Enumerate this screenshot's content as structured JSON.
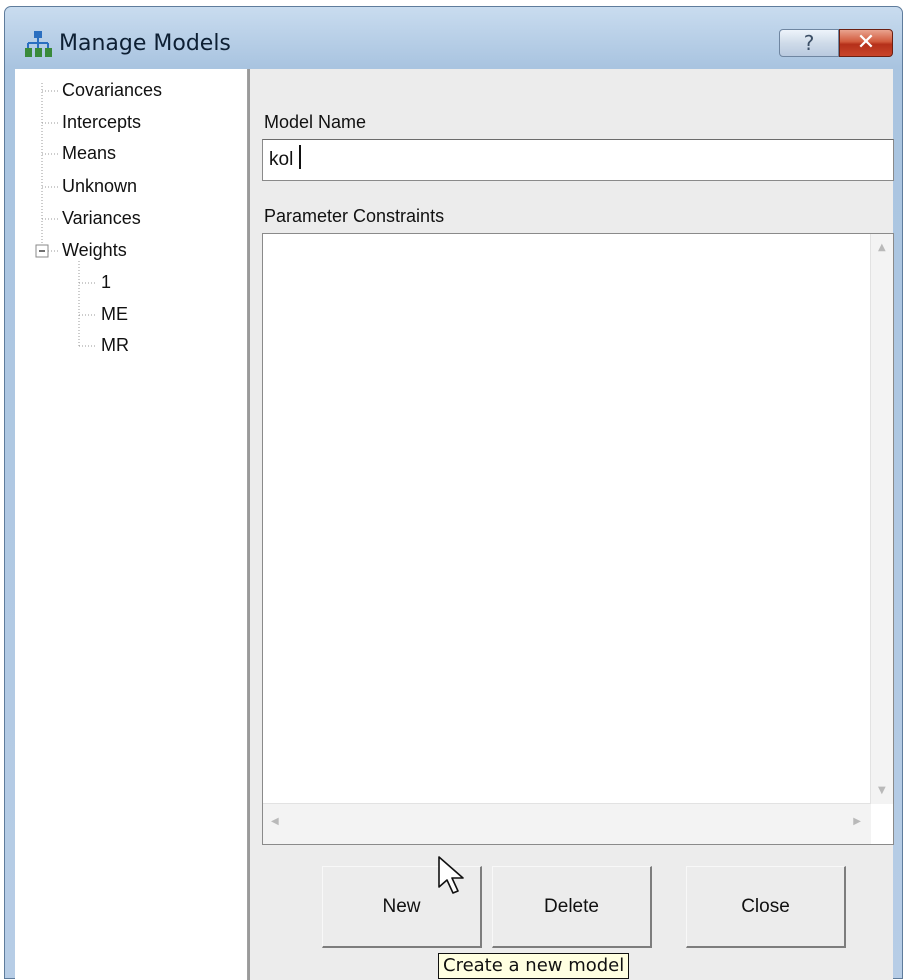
{
  "window": {
    "title": "Manage Models",
    "help_glyph": "?",
    "close_glyph": "✕",
    "icon": "model-tree-icon"
  },
  "tree": {
    "items": [
      {
        "label": "Covariances"
      },
      {
        "label": "Intercepts"
      },
      {
        "label": "Means"
      },
      {
        "label": "Unknown"
      },
      {
        "label": "Variances"
      },
      {
        "label": "Weights",
        "expanded": true,
        "expander_glyph": "−",
        "children": [
          {
            "label": "1"
          },
          {
            "label": "ME"
          },
          {
            "label": "MR"
          }
        ]
      }
    ]
  },
  "form": {
    "model_name_label": "Model Name",
    "model_name_value": "kol",
    "parameter_constraints_label": "Parameter Constraints",
    "parameter_constraints_value": ""
  },
  "buttons": {
    "new_label": "New",
    "delete_label": "Delete",
    "close_label": "Close"
  },
  "tooltip": {
    "text": "Create a new model"
  },
  "colors": {
    "title_gradient_top": "#c9dcef",
    "close_button": "#c9452a",
    "tooltip_bg": "#ffffe1"
  }
}
